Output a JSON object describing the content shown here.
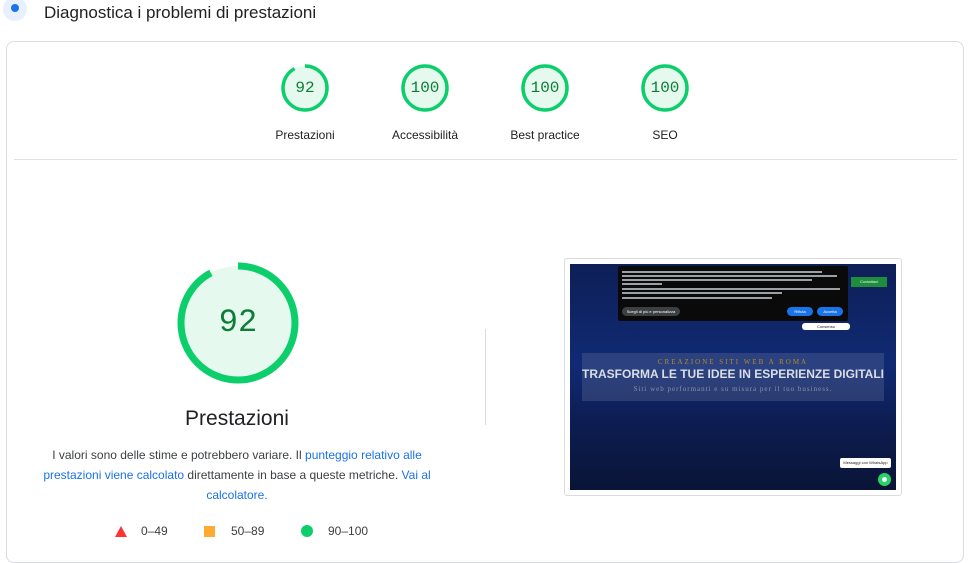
{
  "header": {
    "title": "Diagnostica i problemi di prestazioni"
  },
  "categories": [
    {
      "label": "Prestazioni",
      "score": "92",
      "fraction": 0.92
    },
    {
      "label": "Accessibilità",
      "score": "100",
      "fraction": 1.0
    },
    {
      "label": "Best practice",
      "score": "100",
      "fraction": 1.0
    },
    {
      "label": "SEO",
      "score": "100",
      "fraction": 1.0
    }
  ],
  "main": {
    "score": "92",
    "fraction": 0.92,
    "title": "Prestazioni",
    "desc_before": "I valori sono delle stime e potrebbero variare. Il ",
    "desc_link1": "punteggio relativo alle prestazioni viene calcolato",
    "desc_middle": " direttamente in base a queste metriche. ",
    "desc_link2": "Vai al calcolatore.",
    "legend": [
      {
        "shape": "triangle",
        "range": "0–49",
        "color": "#ff3333"
      },
      {
        "shape": "square",
        "range": "50–89",
        "color": "#ffaa33"
      },
      {
        "shape": "circle",
        "range": "90–100",
        "color": "#0cce6b"
      }
    ]
  },
  "screenshot": {
    "hero_small": "CREAZIONE SITI WEB A ROMA",
    "hero_title": "TRASFORMA LE TUE IDEE IN ESPERIENZE DIGITALI",
    "hero_sub": "Siti web performanti e su misura per il tuo business.",
    "cookie_reject": "Scegli di più e personalizza",
    "cookie_refuse": "Rifiuta",
    "cookie_accept": "Accetta",
    "consent_pill": "Consenso",
    "message_box": "Messaggi con WhatsApp",
    "green_button": "Contattaci"
  },
  "colors": {
    "pass_green": "#0cce6b",
    "pass_text": "#0c7d36",
    "link_blue": "#1a73e8"
  },
  "icons": [
    "lighthouse-icon",
    "triangle-icon",
    "square-icon",
    "circle-icon",
    "whatsapp-icon"
  ]
}
